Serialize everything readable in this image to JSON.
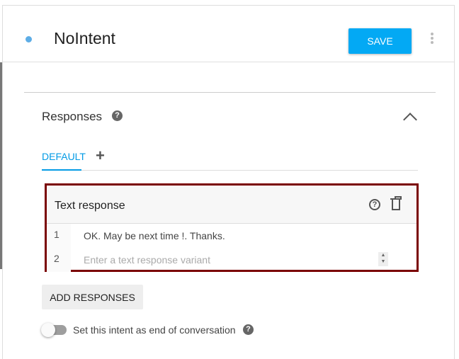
{
  "header": {
    "title": "NoIntent",
    "save_label": "SAVE",
    "status_color": "#5dade6"
  },
  "responses": {
    "title": "Responses",
    "tabs": [
      {
        "label": "DEFAULT"
      }
    ],
    "add_tab": "+",
    "card": {
      "title": "Text response",
      "rows": [
        {
          "num": "1",
          "value": "OK. May be next time !. Thanks."
        },
        {
          "num": "2",
          "value": "",
          "placeholder": "Enter a text response variant"
        }
      ]
    },
    "add_button": "ADD RESPONSES",
    "end_toggle": {
      "label": "Set this intent as end of conversation",
      "on": false
    }
  },
  "help_glyph": "?"
}
